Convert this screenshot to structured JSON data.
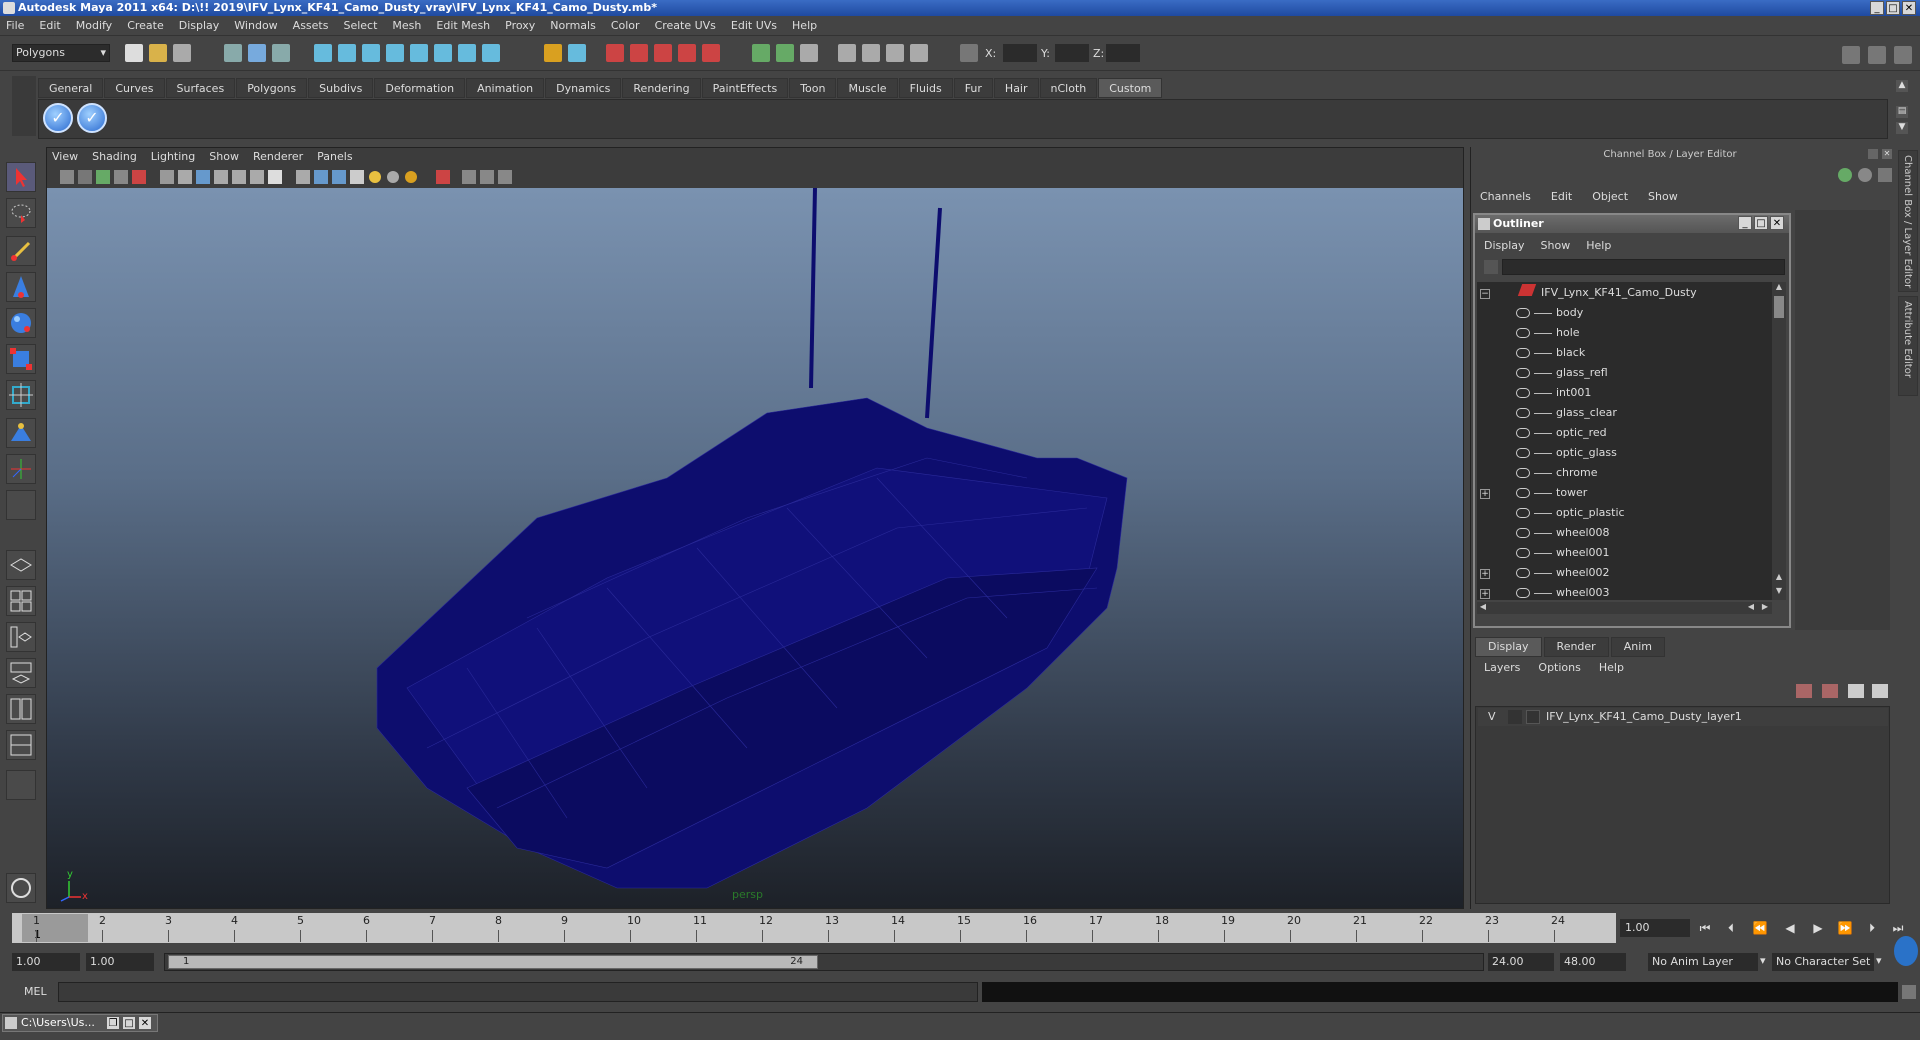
{
  "window": {
    "title": "Autodesk Maya 2011 x64: D:\\!! 2019\\IFV_Lynx_KF41_Camo_Dusty_vray\\IFV_Lynx_KF41_Camo_Dusty.mb*"
  },
  "menubar": [
    "File",
    "Edit",
    "Modify",
    "Create",
    "Display",
    "Window",
    "Assets",
    "Select",
    "Mesh",
    "Edit Mesh",
    "Proxy",
    "Normals",
    "Color",
    "Create UVs",
    "Edit UVs",
    "Help"
  ],
  "status_line": {
    "mode": "Polygons",
    "x_label": "X:",
    "y_label": "Y:",
    "z_label": "Z:"
  },
  "shelf": {
    "tabs": [
      "General",
      "Curves",
      "Surfaces",
      "Polygons",
      "Subdivs",
      "Deformation",
      "Animation",
      "Dynamics",
      "Rendering",
      "PaintEffects",
      "Toon",
      "Muscle",
      "Fluids",
      "Fur",
      "Hair",
      "nCloth",
      "Custom"
    ],
    "active_tab": "Custom"
  },
  "viewport": {
    "menu": [
      "View",
      "Shading",
      "Lighting",
      "Show",
      "Renderer",
      "Panels"
    ],
    "camera": "persp",
    "axis_y": "y",
    "axis_x": "x"
  },
  "channel_box": {
    "title": "Channel Box / Layer Editor",
    "menu": [
      "Channels",
      "Edit",
      "Object",
      "Show"
    ]
  },
  "outliner": {
    "title": "Outliner",
    "menu": [
      "Display",
      "Show",
      "Help"
    ],
    "root": "IFV_Lynx_KF41_Camo_Dusty",
    "items": [
      {
        "name": "body",
        "expandable": false
      },
      {
        "name": "hole",
        "expandable": false
      },
      {
        "name": "black",
        "expandable": false
      },
      {
        "name": "glass_refl",
        "expandable": false
      },
      {
        "name": "int001",
        "expandable": false
      },
      {
        "name": "glass_clear",
        "expandable": false
      },
      {
        "name": "optic_red",
        "expandable": false
      },
      {
        "name": "optic_glass",
        "expandable": false
      },
      {
        "name": "chrome",
        "expandable": false
      },
      {
        "name": "tower",
        "expandable": true
      },
      {
        "name": "optic_plastic",
        "expandable": false
      },
      {
        "name": "wheel008",
        "expandable": false
      },
      {
        "name": "wheel001",
        "expandable": false
      },
      {
        "name": "wheel002",
        "expandable": true
      },
      {
        "name": "wheel003",
        "expandable": true
      }
    ]
  },
  "layer_editor": {
    "tabs": [
      "Display",
      "Render",
      "Anim"
    ],
    "active_tab": "Display",
    "menu": [
      "Layers",
      "Options",
      "Help"
    ],
    "layer": {
      "visible": "V",
      "name": "IFV_Lynx_KF41_Camo_Dusty_layer1"
    }
  },
  "time_slider": {
    "ticks": [
      "1",
      "2",
      "3",
      "4",
      "5",
      "6",
      "7",
      "8",
      "9",
      "10",
      "11",
      "12",
      "13",
      "14",
      "15",
      "16",
      "17",
      "18",
      "19",
      "20",
      "21",
      "22",
      "23",
      "24"
    ],
    "current_frame_marker": "1",
    "current_frame": "1.00"
  },
  "range_slider": {
    "start_time": "1.00",
    "playback_start": "1.00",
    "range_start_label": "1",
    "range_end_label": "24",
    "playback_end": "24.00",
    "end_time": "48.00",
    "anim_layer": "No Anim Layer",
    "character_set": "No Character Set"
  },
  "command_line": {
    "label": "MEL"
  },
  "taskbar": {
    "item": "C:\\Users\\Us..."
  },
  "side_tabs": [
    "Channel Box / Layer Editor",
    "Attribute Editor"
  ],
  "colors": {
    "mesh": "#0d0d6e",
    "title_bar": "#2a56b0",
    "active_tab": "#5a5a5a"
  }
}
